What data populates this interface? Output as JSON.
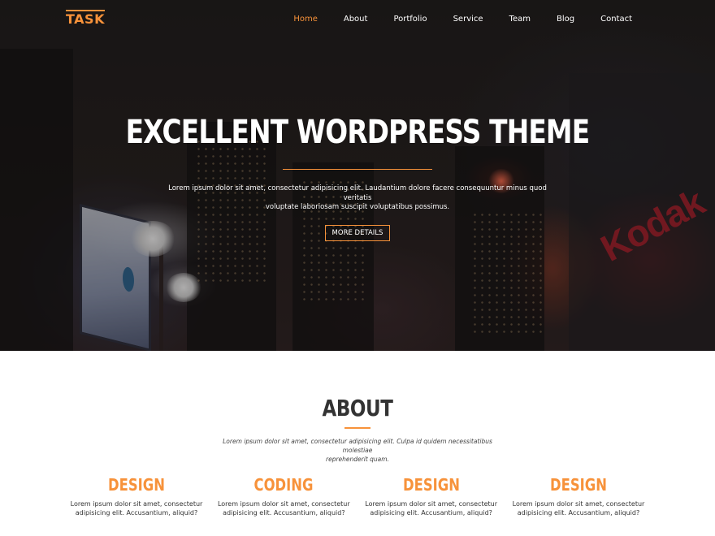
{
  "brand": {
    "logo_text": "TASK",
    "accent_color": "#f7923a"
  },
  "nav": {
    "items": [
      {
        "label": "Home",
        "active": true
      },
      {
        "label": "About",
        "active": false
      },
      {
        "label": "Portfolio",
        "active": false
      },
      {
        "label": "Service",
        "active": false
      },
      {
        "label": "Team",
        "active": false
      },
      {
        "label": "Blog",
        "active": false
      },
      {
        "label": "Contact",
        "active": false
      }
    ]
  },
  "hero": {
    "title": "EXCELLENT WORDPRESS THEME",
    "text_line1": "Lorem ipsum dolor sit amet, consectetur adipisicing elit. Laudantium dolore facere consequuntur minus quod veritatis",
    "text_line2": "voluptate laboriosam suscipit voluptatibus possimus.",
    "button_label": "MORE DETAILS",
    "background_sign_text": "Kodak"
  },
  "about": {
    "title": "ABOUT",
    "text_line1": "Lorem ipsum dolor sit amet, consectetur adipisicing elit. Culpa id quidem necessitatibus molestiae",
    "text_line2": "reprehenderit quam.",
    "features": [
      {
        "title": "DESIGN",
        "line1": "Lorem ipsum dolor sit amet, consectetur",
        "line2": "adipisicing elit. Accusantium, aliquid?"
      },
      {
        "title": "CODING",
        "line1": "Lorem ipsum dolor sit amet, consectetur",
        "line2": "adipisicing elit. Accusantium, aliquid?"
      },
      {
        "title": "DESIGN",
        "line1": "Lorem ipsum dolor sit amet, consectetur",
        "line2": "adipisicing elit. Accusantium, aliquid?"
      },
      {
        "title": "DESIGN",
        "line1": "Lorem ipsum dolor sit amet, consectetur",
        "line2": "adipisicing elit. Accusantium, aliquid?"
      }
    ]
  }
}
